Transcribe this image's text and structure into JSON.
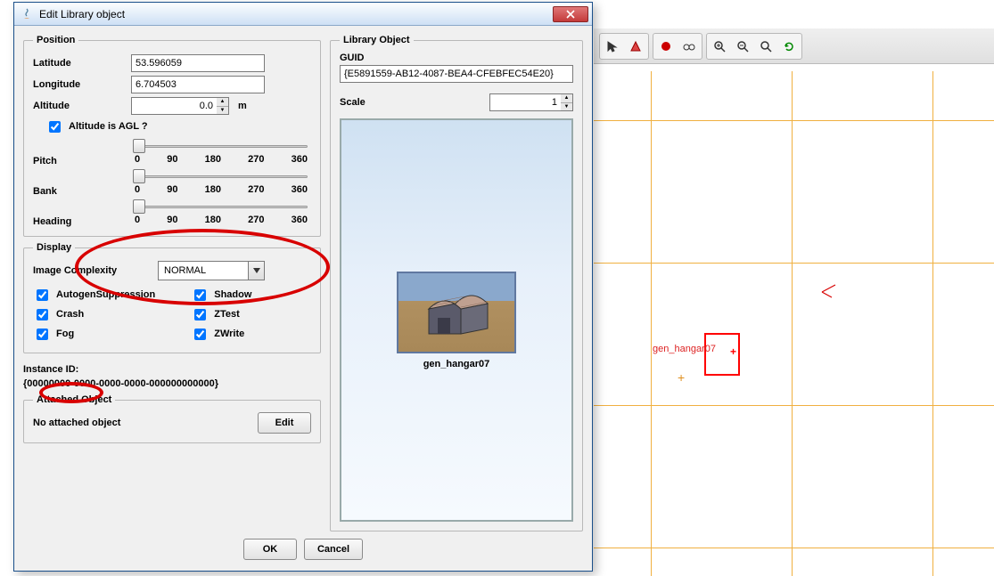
{
  "window": {
    "title": "Edit Library object"
  },
  "position": {
    "legend": "Position",
    "labels": {
      "latitude": "Latitude",
      "longitude": "Longitude",
      "altitude": "Altitude",
      "altitude_unit": "m",
      "altitude_agl": "Altitude is AGL ?",
      "pitch": "Pitch",
      "bank": "Bank",
      "heading": "Heading"
    },
    "values": {
      "latitude": "53.596059",
      "longitude": "6.704503",
      "altitude": "0.0",
      "altitude_agl_checked": true
    },
    "ticks": [
      "0",
      "90",
      "180",
      "270",
      "360"
    ]
  },
  "display": {
    "legend": "Display",
    "labels": {
      "image_complexity": "Image Complexity"
    },
    "image_complexity_value": "NORMAL",
    "checks": {
      "autogen_suppression": "AutogenSuppression",
      "crash": "Crash",
      "fog": "Fog",
      "shadow": "Shadow",
      "ztest": "ZTest",
      "zwrite": "ZWrite"
    }
  },
  "instance": {
    "label": "Instance ID:",
    "value": "{00000000-0000-0000-0000-000000000000}"
  },
  "attached": {
    "legend": "Attached Object",
    "none_text": "No attached object",
    "edit_label": "Edit"
  },
  "library_object": {
    "legend": "Library Object",
    "guid_label": "GUID",
    "guid_value": "{E5891559-AB12-4087-BEA4-CFEBFEC54E20}",
    "scale_label": "Scale",
    "scale_value": "1",
    "preview_name": "gen_hangar07"
  },
  "buttons": {
    "ok": "OK",
    "cancel": "Cancel"
  },
  "map": {
    "label": "gen_hangar07"
  }
}
